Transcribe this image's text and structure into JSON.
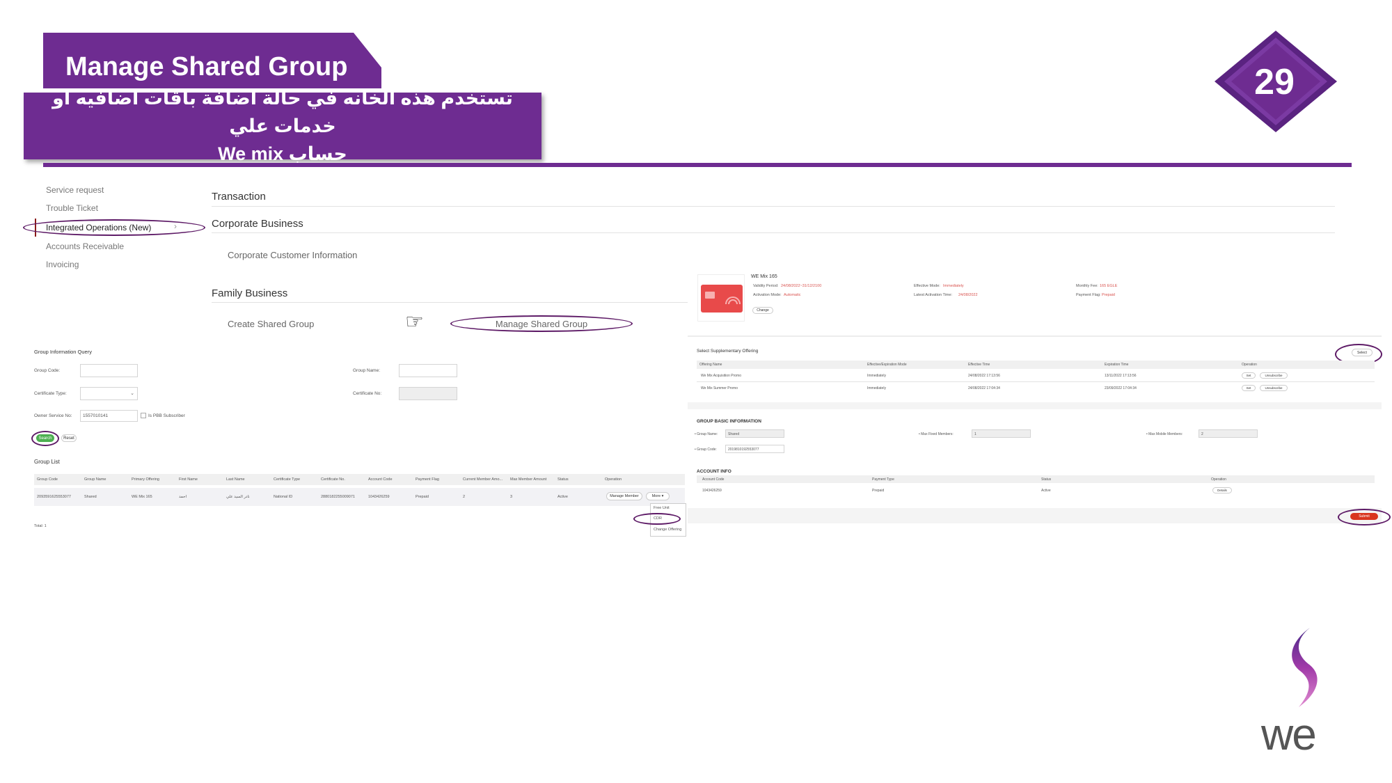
{
  "slide": {
    "title": "Manage Shared Group",
    "arabic_line1": "تستخدم هذه الخانه في حالة اضافة باقات اضافيه او خدمات علي",
    "arabic_line2": "حساب  We mix",
    "page_number": "29",
    "logo_text": "we",
    "accent_color": "#6e2c91",
    "highlight_color": "#5d1a66"
  },
  "nav": {
    "items": [
      "Service request",
      "Trouble Ticket",
      "Integrated Operations (New)",
      "Accounts Receivable",
      "Invoicing"
    ],
    "chevron": "chevron-right-icon"
  },
  "menu": {
    "transaction": "Transaction",
    "corporate_business": "Corporate Business",
    "corporate_customer_info": "Corporate Customer Information",
    "family_business": "Family Business",
    "create_shared_group": "Create Shared Group",
    "manage_shared_group": "Manage Shared Group",
    "pointer_icon": "hand-pointer-icon",
    "pointer_glyph": "☞"
  },
  "query": {
    "title": "Group Information Query",
    "group_code_label": "Group Code:",
    "group_name_label": "Group Name:",
    "certificate_type_label": "Certificate Type:",
    "certificate_no_label": "Certificate No:",
    "owner_service_label": "Owner Service No:",
    "owner_service_value": "1557010141",
    "pbb_label": "Is PBB Subscriber",
    "search_button": "Search",
    "reset_button": "Reset"
  },
  "group_list": {
    "title": "Group List",
    "columns": [
      "Group Code",
      "Group Name",
      "Primary Offering",
      "First Name",
      "Last Name",
      "Certificate Type",
      "Certificate No.",
      "Account Code",
      "Payment Flag",
      "Current Member Amo...",
      "Max Member Amount",
      "Status",
      "Operation"
    ],
    "row": [
      "2093591625553077",
      "Shared",
      "WE Mix 165",
      "احمد",
      "نادر السيد علي",
      "National ID",
      "2880182255009071",
      "1043426259",
      "Prepaid",
      "2",
      "3",
      "Active"
    ],
    "manage_member": "Manage Member",
    "more": "More ▾",
    "dropdown": [
      "Free Unit",
      "CDR",
      "Change Offering"
    ],
    "total_label": "Total: 1"
  },
  "offering": {
    "name": "WE Mix 165",
    "validity_label": "Validity Period:",
    "validity_value": "24/08/2022~31/12/2100",
    "activation_label": "Activation Mode:",
    "activation_value": "Automatic",
    "change_button": "Change",
    "effective_mode_label": "Effective Mode:",
    "effective_mode_value": "Immediately",
    "latest_activation_label": "Latest Activation Time:",
    "latest_activation_value": "24/08/2022",
    "monthly_fee_label": "Monthly Fee:",
    "monthly_fee_value": "165 EGLE",
    "payment_flag_label": "Payment Flag:",
    "payment_flag_value": "Prepaid"
  },
  "supplementary": {
    "title": "Select Supplementary Offering",
    "select_button": "Select",
    "columns": [
      "Offering Name",
      "Effective/Expiration Mode",
      "Effective Time",
      "Expiration Time",
      "Operation"
    ],
    "rows": [
      [
        "We Mix Acquisition Promo",
        "Immediately",
        "24/08/2022 17:13:56",
        "13/11/2022 17:13:56"
      ],
      [
        "We Mix Summer Promo",
        "Immediately",
        "24/08/2022 17:04:34",
        "23/09/2022 17:04:34"
      ]
    ],
    "set_button": "Set",
    "unsub_button": "Unsubscribe"
  },
  "group_basic": {
    "title": "GROUP BASIC INFORMATION",
    "group_name_label": "• Group Name:",
    "group_name_value": "Shared",
    "max_fixed_label": "• Max Fixed Members:",
    "max_fixed_value": "1",
    "max_mobile_label": "• Max Mobile Members:",
    "max_mobile_value": "2",
    "group_code_label": "• Group Code:",
    "group_code_value": "2019810192553077"
  },
  "account": {
    "title": "ACCOUNT INFO",
    "columns": [
      "Account Code",
      "Payment Type",
      "Status",
      "Operation"
    ],
    "row": [
      "1043426259",
      "Prepaid",
      "Active"
    ],
    "details_button": "Details",
    "submit_button": "Submit"
  }
}
